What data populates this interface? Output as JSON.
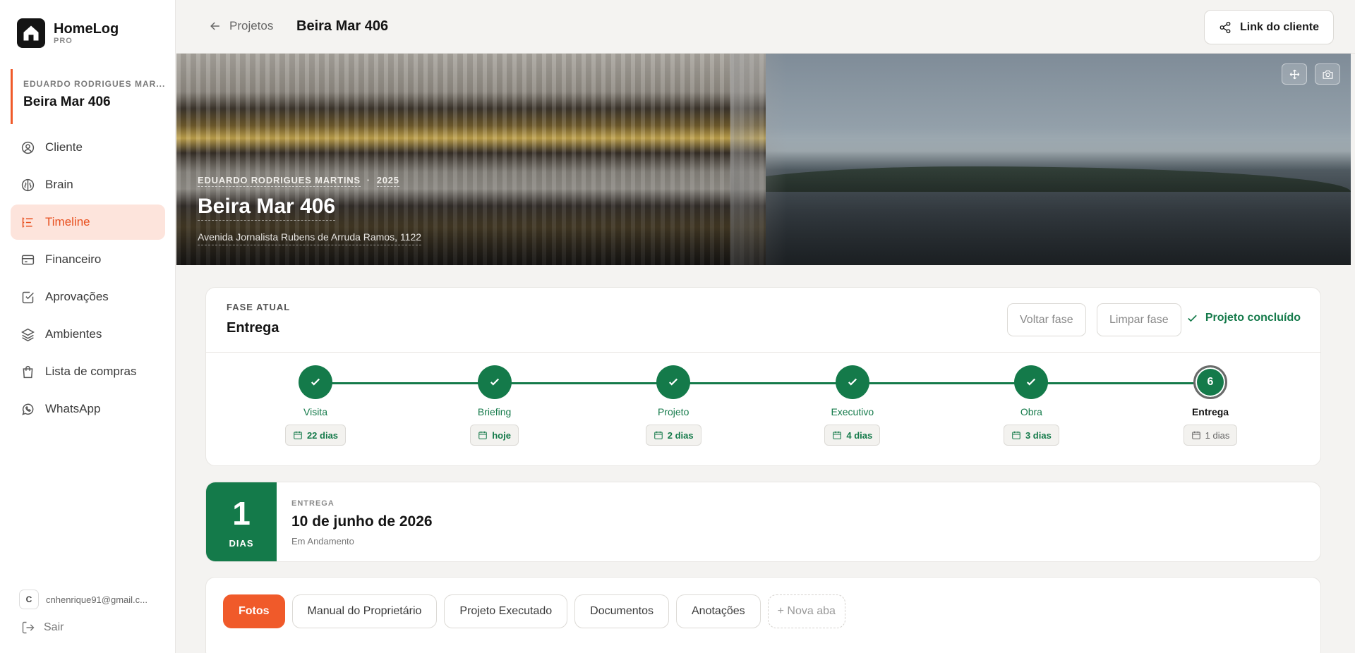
{
  "brand": {
    "name": "HomeLog",
    "tier": "PRO"
  },
  "sidebar": {
    "project_client": "EDUARDO RODRIGUES MAR...",
    "project_name": "Beira Mar 406",
    "items": [
      {
        "label": "Cliente",
        "icon": "user-circle-icon"
      },
      {
        "label": "Brain",
        "icon": "brain-icon"
      },
      {
        "label": "Timeline",
        "icon": "timeline-icon",
        "active": true
      },
      {
        "label": "Financeiro",
        "icon": "credit-card-icon"
      },
      {
        "label": "Aprovações",
        "icon": "check-square-icon"
      },
      {
        "label": "Ambientes",
        "icon": "layers-icon"
      },
      {
        "label": "Lista de compras",
        "icon": "shopping-bag-icon"
      },
      {
        "label": "WhatsApp",
        "icon": "whatsapp-icon"
      }
    ],
    "user_initial": "C",
    "user_email": "cnhenrique91@gmail.c...",
    "logout_label": "Sair"
  },
  "topbar": {
    "back_label": "Projetos",
    "title": "Beira Mar 406",
    "client_link_label": "Link do cliente"
  },
  "hero": {
    "client": "EDUARDO RODRIGUES MARTINS",
    "separator": "·",
    "year": "2025",
    "title": "Beira Mar 406",
    "address": "Avenida Jornalista Rubens de Arruda Ramos, 1122"
  },
  "phase": {
    "label": "FASE ATUAL",
    "value": "Entrega",
    "back_label": "Voltar fase",
    "clear_label": "Limpar fase",
    "done_label": "Projeto concluído",
    "steps": [
      {
        "name": "Visita",
        "badge": "22 dias",
        "done": true
      },
      {
        "name": "Briefing",
        "badge": "hoje",
        "done": true
      },
      {
        "name": "Projeto",
        "badge": "2 dias",
        "done": true
      },
      {
        "name": "Executivo",
        "badge": "4 dias",
        "done": true
      },
      {
        "name": "Obra",
        "badge": "3 dias",
        "done": true
      },
      {
        "name": "Entrega",
        "badge": "1 dias",
        "done": false,
        "number": "6"
      }
    ]
  },
  "countdown": {
    "number": "1",
    "unit": "DIAS",
    "label": "ENTREGA",
    "date": "10 de junho de 2026",
    "status": "Em Andamento"
  },
  "tabs": [
    {
      "label": "Fotos",
      "active": true
    },
    {
      "label": "Manual do Proprietário"
    },
    {
      "label": "Projeto Executado"
    },
    {
      "label": "Documentos"
    },
    {
      "label": "Anotações"
    },
    {
      "label": "+ Nova aba",
      "new": true
    }
  ],
  "colors": {
    "accent": "#f05a2a",
    "success": "#147a4a",
    "active_bg": "#fde4dc"
  }
}
